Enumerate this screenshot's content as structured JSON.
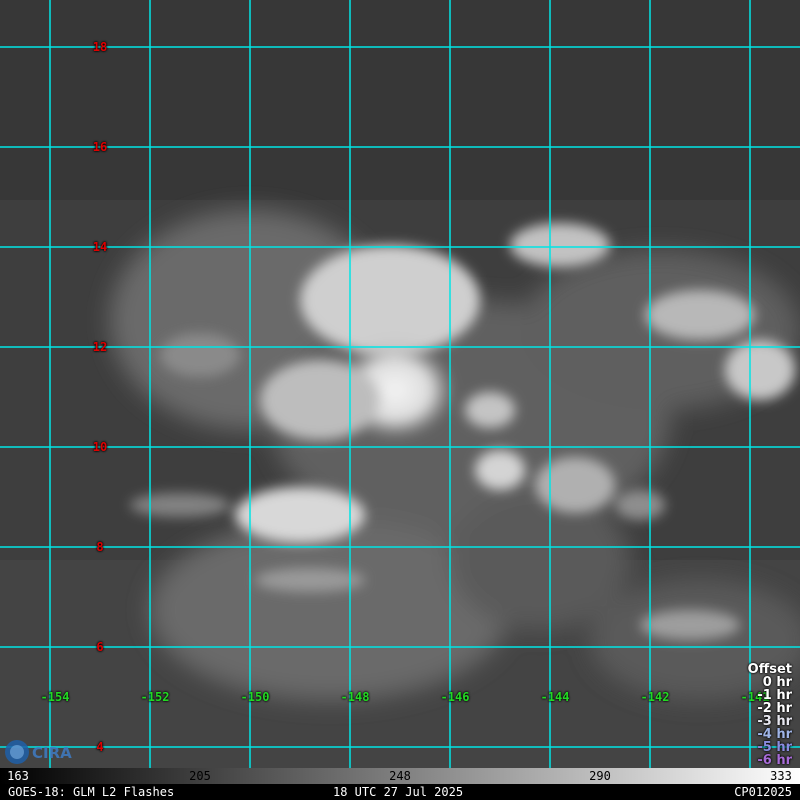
{
  "map": {
    "latitude_labels": [
      "18",
      "16",
      "14",
      "12",
      "10",
      "8",
      "6",
      "4"
    ],
    "longitude_labels": [
      "-154",
      "-152",
      "-150",
      "-148",
      "-146",
      "-144",
      "-142",
      "-141"
    ],
    "grid_color": "#00e5e5",
    "latitude_label_color": "#e00000",
    "longitude_label_color": "#22d822"
  },
  "offset_legend": {
    "title": "Offset",
    "entries": [
      {
        "label": "0 hr",
        "color": "#ffffff"
      },
      {
        "label": "-1 hr",
        "color": "#ffffff"
      },
      {
        "label": "-2 hr",
        "color": "#ffffff"
      },
      {
        "label": "-3 hr",
        "color": "#e8e8f0"
      },
      {
        "label": "-4 hr",
        "color": "#9fb4e6"
      },
      {
        "label": "-5 hr",
        "color": "#8a8ce0"
      },
      {
        "label": "-6 hr",
        "color": "#a86cd8"
      }
    ]
  },
  "color_scale": {
    "labels": [
      "163",
      "205",
      "248",
      "290",
      "333"
    ]
  },
  "footer": {
    "satellite_product": "GOES-18: GLM L2 Flashes",
    "datetime": "18 UTC 27 Jul 2025",
    "storm_id": "CP012025"
  },
  "logo": {
    "icon": "cira-logo-icon",
    "text": "CIRA"
  }
}
